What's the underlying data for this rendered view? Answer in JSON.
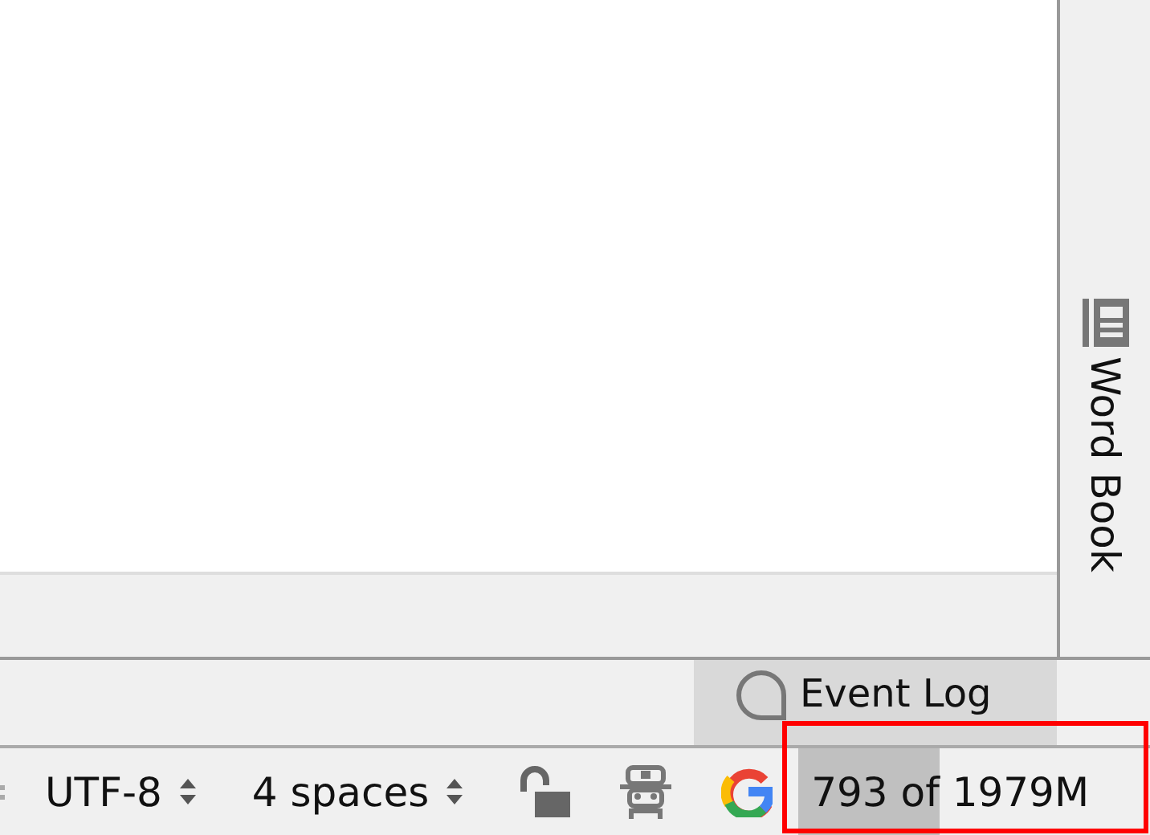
{
  "right_sidebar": {
    "tabs": [
      {
        "label": "Word Book"
      }
    ]
  },
  "tool_window_bar": {
    "tabs": [
      {
        "label": "Event Log"
      }
    ]
  },
  "status_bar": {
    "items": [
      {
        "kind": "dropdown",
        "label": "UTF-8"
      },
      {
        "kind": "dropdown",
        "label": "4 spaces"
      },
      {
        "kind": "lock",
        "locked": false
      },
      {
        "kind": "inspector"
      },
      {
        "kind": "google"
      },
      {
        "kind": "memory",
        "label": "793 of 1979M",
        "level": 0.4
      }
    ]
  }
}
